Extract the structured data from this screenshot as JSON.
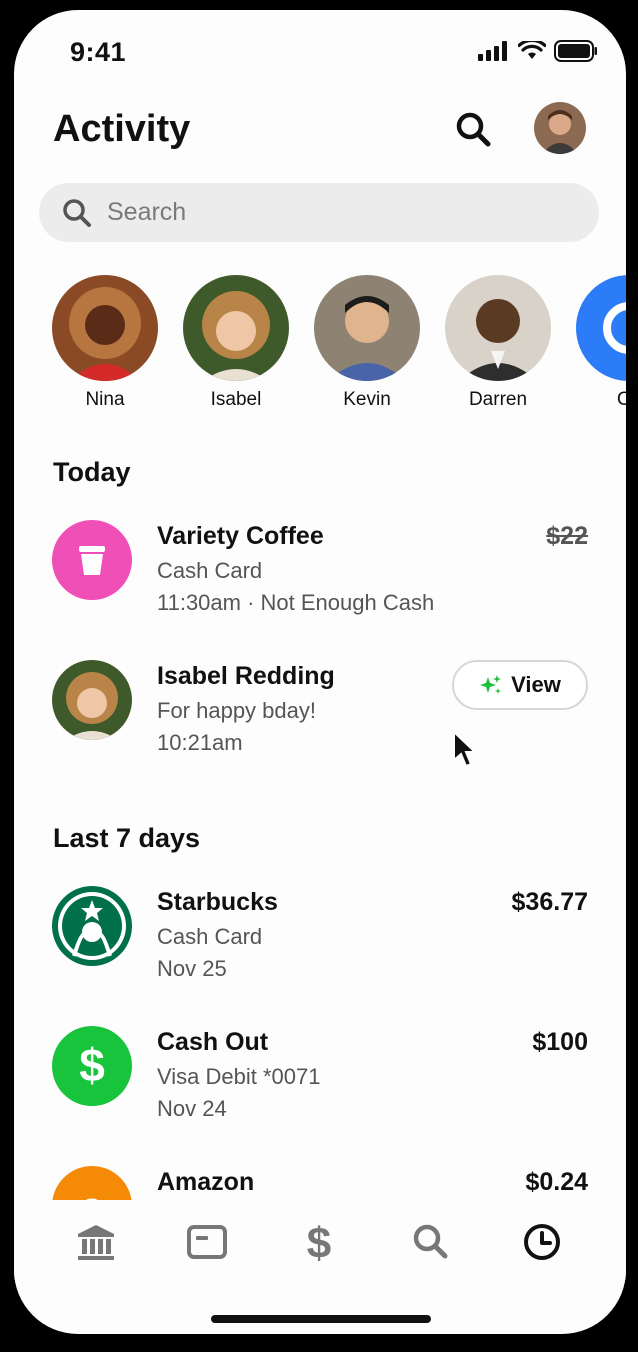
{
  "status": {
    "time": "9:41"
  },
  "header": {
    "title": "Activity"
  },
  "search": {
    "placeholder": "Search"
  },
  "contacts": [
    {
      "name": "Nina",
      "color": "#b56a3a"
    },
    {
      "name": "Isabel",
      "color": "#3f5a2a"
    },
    {
      "name": "Kevin",
      "color": "#8a7a6a"
    },
    {
      "name": "Darren",
      "color": "#d9d2c8"
    },
    {
      "name": "Ca",
      "color": "#2b7cf6"
    }
  ],
  "sections": {
    "today": "Today",
    "last7": "Last 7 days"
  },
  "today_items": [
    {
      "title": "Variety Coffee",
      "subtitle": "Cash Card",
      "detail": "11:30am · Not Enough Cash",
      "amount": "$22",
      "icon": "coffee-cup-icon",
      "icon_color": "#f04fb8"
    },
    {
      "title": "Isabel Redding",
      "subtitle": "For happy bday!",
      "detail": "10:21am",
      "action": "View",
      "icon": "sparkles-icon"
    }
  ],
  "last7_items": [
    {
      "title": "Starbucks",
      "subtitle": "Cash Card",
      "detail": "Nov 25",
      "amount": "$36.77",
      "icon_color": "#00704a"
    },
    {
      "title": "Cash Out",
      "subtitle": "Visa Debit *0071",
      "detail": "Nov 24",
      "amount": "$100",
      "icon_color": "#18c43b"
    },
    {
      "title": "Amazon",
      "amount": "$0.24",
      "icon_color": "#f58a07"
    }
  ],
  "tabs": [
    {
      "icon": "bank-icon"
    },
    {
      "icon": "card-icon"
    },
    {
      "icon": "dollar-icon"
    },
    {
      "icon": "search-icon"
    },
    {
      "icon": "activity-clock-icon",
      "active": true
    }
  ]
}
